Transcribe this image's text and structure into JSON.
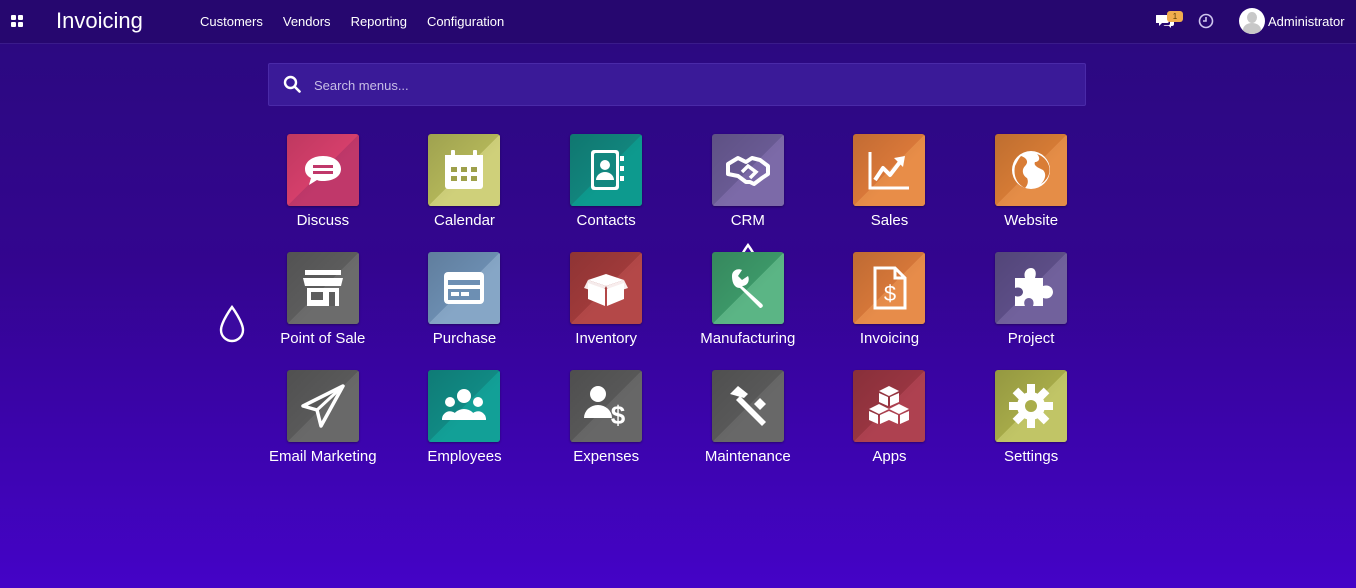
{
  "navbar": {
    "apps_icon": "grid-icon",
    "brand": "Invoicing",
    "menu": [
      "Customers",
      "Vendors",
      "Reporting",
      "Configuration"
    ],
    "chat_icon": "comments-icon",
    "chat_count": "1",
    "activity_icon": "clock-icon",
    "user": {
      "avatar_icon": "user-avatar-icon",
      "name": "Administrator"
    }
  },
  "search": {
    "icon": "search-icon",
    "placeholder": "Search menus..."
  },
  "apps": [
    {
      "label": "Discuss",
      "icon": "chat-bubble-icon",
      "color": "#d9406d",
      "color2": "#c0386a"
    },
    {
      "label": "Calendar",
      "icon": "calendar-icon",
      "color": "#b5b85a",
      "color2": "#cfd07a"
    },
    {
      "label": "Contacts",
      "icon": "address-book-icon",
      "color": "#12877f",
      "color2": "#0d9a8e"
    },
    {
      "label": "CRM",
      "icon": "handshake-icon",
      "color": "#6b5c96",
      "color2": "#7c6aa8"
    },
    {
      "label": "Sales",
      "icon": "trend-chart-icon",
      "color": "#dd7a3a",
      "color2": "#e88d48"
    },
    {
      "label": "Website",
      "icon": "globe-icon",
      "color": "#d97d36",
      "color2": "#e58d47"
    },
    {
      "label": "Point of Sale",
      "icon": "store-icon",
      "color": "#5e5e5e",
      "color2": "#6c6c6c"
    },
    {
      "label": "Purchase",
      "icon": "credit-card-icon",
      "color": "#6d8fb3",
      "color2": "#86a6c6"
    },
    {
      "label": "Inventory",
      "icon": "box-icon",
      "color": "#a23b3b",
      "color2": "#b44848"
    },
    {
      "label": "Manufacturing",
      "icon": "wrench-icon",
      "color": "#3d9a6a",
      "color2": "#5bb585"
    },
    {
      "label": "Invoicing",
      "icon": "invoice-dollar-icon",
      "color": "#d9793a",
      "color2": "#e78c4a"
    },
    {
      "label": "Project",
      "icon": "puzzle-icon",
      "color": "#5e4f89",
      "color2": "#71619c"
    },
    {
      "label": "Email Marketing",
      "icon": "paper-plane-icon",
      "color": "#5b5b5b",
      "color2": "#696969"
    },
    {
      "label": "Employees",
      "icon": "people-icon",
      "color": "#118c86",
      "color2": "#12a097"
    },
    {
      "label": "Expenses",
      "icon": "user-dollar-icon",
      "color": "#595959",
      "color2": "#676767"
    },
    {
      "label": "Maintenance",
      "icon": "hammer-icon",
      "color": "#5a5a5a",
      "color2": "#686868"
    },
    {
      "label": "Apps",
      "icon": "cubes-icon",
      "color": "#9b3642",
      "color2": "#ae4150"
    },
    {
      "label": "Settings",
      "icon": "gear-icon",
      "color": "#a9ad4a",
      "color2": "#c1c566"
    }
  ]
}
